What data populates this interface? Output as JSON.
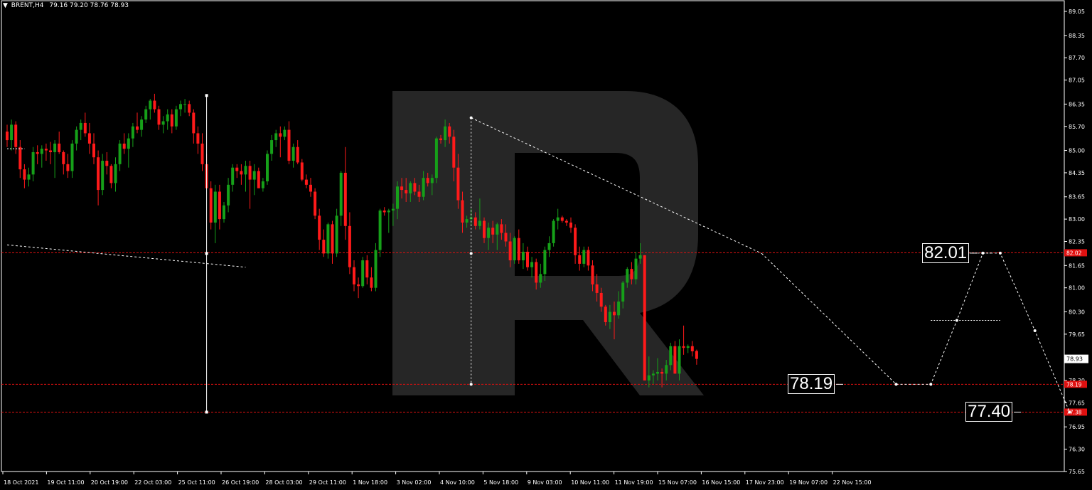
{
  "header": {
    "symbol": "BRENT,H4",
    "ohlc": "79.16 79.20 78.76 78.93"
  },
  "colors": {
    "background": "#000000",
    "bull_candle": "#16a019",
    "bear_candle": "#ff1a1a",
    "level_line": "#e01010",
    "forecast_line": "#ffffff",
    "axis_text": "#ffffff",
    "watermark": "#2b2b2b"
  },
  "chart_data": {
    "type": "candlestick",
    "ylim": [
      75.65,
      89.05
    ],
    "y_ticks": [
      "89.05",
      "88.35",
      "87.70",
      "87.05",
      "86.35",
      "85.70",
      "85.00",
      "84.35",
      "83.65",
      "83.00",
      "82.35",
      "81.65",
      "81.00",
      "80.30",
      "79.65",
      "78.98",
      "78.30",
      "77.65",
      "76.95",
      "76.30",
      "75.65"
    ],
    "x_tick_labels": [
      "18 Oct 2021",
      "19 Oct 11:00",
      "20 Oct 19:00",
      "22 Oct 03:00",
      "25 Oct 11:00",
      "26 Oct 19:00",
      "28 Oct 03:00",
      "29 Oct 11:00",
      "1 Nov 18:00",
      "3 Nov 02:00",
      "4 Nov 10:00",
      "5 Nov 18:00",
      "9 Nov 03:00",
      "10 Nov 11:00",
      "11 Nov 19:00",
      "15 Nov 07:00",
      "16 Nov 15:00",
      "17 Nov 23:00",
      "19 Nov 07:00",
      "22 Nov 15:00"
    ],
    "candles_ohlc": [
      [
        85.55,
        85.75,
        85.1,
        85.3
      ],
      [
        85.3,
        85.9,
        85.0,
        85.75
      ],
      [
        85.75,
        85.85,
        84.9,
        85.1
      ],
      [
        85.1,
        85.3,
        84.2,
        84.45
      ],
      [
        84.45,
        84.6,
        83.9,
        84.15
      ],
      [
        84.15,
        84.5,
        83.95,
        84.3
      ],
      [
        84.3,
        85.1,
        84.1,
        84.95
      ],
      [
        84.95,
        85.15,
        84.6,
        84.9
      ],
      [
        84.9,
        85.15,
        84.5,
        85.05
      ],
      [
        85.05,
        85.2,
        84.7,
        85.0
      ],
      [
        85.0,
        85.25,
        84.6,
        84.95
      ],
      [
        84.95,
        85.3,
        84.2,
        85.2
      ],
      [
        85.2,
        85.55,
        84.9,
        84.95
      ],
      [
        84.95,
        85.0,
        84.3,
        84.6
      ],
      [
        84.6,
        84.9,
        84.2,
        84.4
      ],
      [
        84.4,
        85.3,
        84.2,
        85.2
      ],
      [
        85.2,
        85.7,
        85.0,
        85.6
      ],
      [
        85.6,
        85.9,
        85.3,
        85.8
      ],
      [
        85.8,
        86.1,
        85.4,
        85.5
      ],
      [
        85.5,
        85.8,
        84.9,
        85.2
      ],
      [
        85.2,
        85.5,
        84.6,
        84.8
      ],
      [
        84.8,
        85.0,
        83.4,
        83.85
      ],
      [
        83.85,
        84.9,
        83.7,
        84.7
      ],
      [
        84.7,
        84.95,
        84.3,
        84.55
      ],
      [
        84.55,
        84.6,
        83.9,
        84.05
      ],
      [
        84.05,
        84.8,
        83.8,
        84.6
      ],
      [
        84.6,
        85.3,
        84.4,
        85.2
      ],
      [
        85.2,
        85.5,
        84.9,
        85.05
      ],
      [
        85.05,
        85.5,
        84.5,
        85.35
      ],
      [
        85.35,
        85.8,
        85.1,
        85.7
      ],
      [
        85.7,
        86.1,
        85.5,
        85.6
      ],
      [
        85.6,
        86.0,
        85.4,
        85.9
      ],
      [
        85.9,
        86.3,
        85.8,
        86.2
      ],
      [
        86.2,
        86.5,
        85.9,
        86.45
      ],
      [
        86.45,
        86.65,
        86.1,
        86.2
      ],
      [
        86.2,
        86.3,
        85.6,
        85.75
      ],
      [
        85.75,
        86.0,
        85.5,
        85.85
      ],
      [
        85.85,
        86.2,
        85.6,
        86.05
      ],
      [
        86.05,
        86.2,
        85.5,
        85.7
      ],
      [
        85.7,
        86.3,
        85.6,
        86.2
      ],
      [
        86.2,
        86.45,
        86.0,
        86.35
      ],
      [
        86.35,
        86.5,
        86.1,
        86.35
      ],
      [
        86.35,
        86.45,
        86.0,
        86.1
      ],
      [
        86.1,
        86.2,
        85.2,
        85.5
      ],
      [
        85.5,
        85.7,
        84.9,
        85.2
      ],
      [
        85.2,
        85.5,
        84.4,
        84.6
      ],
      [
        84.6,
        84.9,
        83.9,
        83.9
      ],
      [
        83.9,
        84.1,
        82.7,
        82.9
      ],
      [
        82.9,
        84.0,
        82.3,
        83.8
      ],
      [
        83.8,
        84.0,
        82.7,
        83.0
      ],
      [
        83.0,
        83.5,
        82.9,
        83.4
      ],
      [
        83.4,
        84.2,
        83.2,
        84.0
      ],
      [
        84.0,
        84.6,
        83.8,
        84.5
      ],
      [
        84.5,
        84.6,
        84.2,
        84.4
      ],
      [
        84.4,
        84.6,
        84.0,
        84.3
      ],
      [
        84.3,
        84.7,
        83.8,
        84.55
      ],
      [
        84.55,
        84.7,
        83.3,
        84.15
      ],
      [
        84.15,
        84.6,
        83.7,
        84.4
      ],
      [
        84.4,
        84.5,
        83.9,
        83.9
      ],
      [
        83.9,
        84.2,
        83.8,
        84.1
      ],
      [
        84.1,
        85.0,
        84.0,
        84.9
      ],
      [
        84.9,
        85.45,
        84.7,
        85.3
      ],
      [
        85.3,
        85.6,
        85.1,
        85.5
      ],
      [
        85.5,
        85.7,
        84.8,
        85.4
      ],
      [
        85.4,
        85.7,
        85.3,
        85.6
      ],
      [
        85.6,
        85.85,
        84.6,
        84.7
      ],
      [
        84.7,
        85.2,
        84.5,
        85.1
      ],
      [
        85.1,
        85.3,
        84.6,
        84.65
      ],
      [
        84.65,
        84.75,
        84.1,
        84.15
      ],
      [
        84.15,
        84.3,
        83.9,
        84.0
      ],
      [
        84.0,
        84.2,
        83.65,
        83.8
      ],
      [
        83.8,
        83.9,
        83.0,
        83.1
      ],
      [
        83.1,
        83.3,
        82.1,
        82.4
      ],
      [
        82.4,
        82.7,
        81.9,
        82.0
      ],
      [
        82.0,
        82.9,
        81.85,
        82.85
      ],
      [
        82.85,
        82.95,
        81.7,
        82.0
      ],
      [
        82.0,
        83.3,
        81.9,
        83.1
      ],
      [
        83.1,
        84.4,
        82.8,
        84.35
      ],
      [
        84.35,
        85.1,
        82.4,
        82.8
      ],
      [
        82.8,
        83.2,
        81.4,
        81.6
      ],
      [
        81.6,
        81.8,
        80.9,
        81.1
      ],
      [
        81.1,
        81.3,
        80.7,
        81.05
      ],
      [
        81.05,
        81.9,
        81.0,
        81.8
      ],
      [
        81.8,
        81.95,
        81.1,
        81.3
      ],
      [
        81.3,
        81.6,
        80.9,
        81.0
      ],
      [
        81.0,
        82.3,
        80.9,
        82.1
      ],
      [
        82.1,
        83.3,
        81.9,
        83.25
      ],
      [
        83.25,
        83.35,
        83.1,
        83.2
      ],
      [
        83.2,
        83.3,
        82.6,
        83.25
      ],
      [
        83.25,
        83.45,
        82.8,
        83.3
      ],
      [
        83.3,
        84.1,
        83.0,
        83.95
      ],
      [
        83.95,
        84.2,
        83.6,
        83.85
      ],
      [
        83.85,
        84.2,
        83.5,
        83.75
      ],
      [
        83.75,
        84.1,
        83.5,
        84.05
      ],
      [
        84.05,
        84.2,
        83.7,
        83.8
      ],
      [
        83.8,
        84.0,
        83.5,
        83.65
      ],
      [
        83.65,
        84.4,
        83.55,
        84.2
      ],
      [
        84.2,
        84.35,
        83.95,
        84.05
      ],
      [
        84.05,
        84.3,
        83.7,
        84.2
      ],
      [
        84.2,
        85.4,
        84.05,
        85.35
      ],
      [
        85.35,
        85.45,
        85.2,
        85.3
      ],
      [
        85.3,
        85.9,
        85.1,
        85.7
      ],
      [
        85.7,
        85.8,
        85.2,
        85.4
      ],
      [
        85.4,
        85.6,
        84.1,
        84.5
      ],
      [
        84.5,
        84.9,
        83.3,
        83.55
      ],
      [
        83.55,
        83.8,
        82.6,
        82.9
      ],
      [
        82.9,
        83.1,
        82.75,
        83.0
      ],
      [
        83.0,
        83.3,
        82.8,
        83.05
      ],
      [
        83.05,
        83.2,
        82.7,
        82.8
      ],
      [
        82.8,
        83.6,
        82.7,
        82.95
      ],
      [
        82.95,
        83.05,
        82.3,
        82.45
      ],
      [
        82.45,
        82.9,
        82.1,
        82.75
      ],
      [
        82.75,
        82.95,
        82.3,
        82.55
      ],
      [
        82.55,
        82.9,
        82.1,
        82.85
      ],
      [
        82.85,
        83.0,
        82.4,
        82.6
      ],
      [
        82.6,
        82.85,
        82.2,
        82.35
      ],
      [
        82.35,
        82.6,
        81.6,
        81.8
      ],
      [
        81.8,
        82.5,
        81.7,
        82.45
      ],
      [
        82.45,
        82.7,
        81.7,
        81.8
      ],
      [
        81.8,
        82.3,
        81.55,
        82.05
      ],
      [
        82.05,
        82.2,
        81.5,
        81.6
      ],
      [
        81.6,
        81.9,
        81.3,
        81.75
      ],
      [
        81.75,
        81.85,
        80.95,
        81.15
      ],
      [
        81.15,
        81.7,
        81.0,
        81.4
      ],
      [
        81.4,
        82.2,
        81.2,
        82.1
      ],
      [
        82.1,
        82.5,
        81.9,
        82.3
      ],
      [
        82.3,
        83.0,
        82.2,
        82.95
      ],
      [
        82.95,
        83.3,
        82.7,
        83.05
      ],
      [
        83.05,
        83.1,
        82.9,
        82.95
      ],
      [
        82.95,
        83.0,
        82.8,
        82.9
      ],
      [
        82.9,
        83.05,
        82.6,
        82.75
      ],
      [
        82.75,
        82.85,
        81.7,
        81.95
      ],
      [
        81.95,
        82.2,
        81.5,
        81.7
      ],
      [
        81.7,
        82.2,
        81.6,
        82.1
      ],
      [
        82.1,
        82.2,
        81.5,
        81.65
      ],
      [
        81.65,
        81.8,
        80.9,
        81.1
      ],
      [
        81.1,
        81.4,
        80.6,
        80.85
      ],
      [
        80.85,
        81.0,
        80.3,
        80.45
      ],
      [
        80.45,
        80.5,
        79.9,
        80.0
      ],
      [
        80.0,
        80.5,
        79.8,
        80.3
      ],
      [
        80.3,
        80.6,
        79.5,
        80.2
      ],
      [
        80.2,
        80.9,
        80.1,
        80.6
      ],
      [
        80.6,
        81.2,
        80.4,
        81.15
      ],
      [
        81.15,
        81.6,
        81.0,
        81.55
      ],
      [
        81.55,
        81.75,
        81.1,
        81.25
      ],
      [
        81.25,
        82.05,
        81.1,
        81.85
      ],
      [
        81.85,
        82.3,
        81.7,
        81.95
      ],
      [
        81.95,
        81.95,
        78.3,
        78.3
      ],
      [
        78.3,
        79.0,
        78.1,
        78.45
      ],
      [
        78.45,
        78.6,
        78.2,
        78.5
      ],
      [
        78.5,
        78.95,
        78.3,
        78.55
      ],
      [
        78.55,
        78.65,
        78.1,
        78.5
      ],
      [
        78.5,
        78.9,
        78.3,
        78.75
      ],
      [
        78.75,
        79.4,
        78.6,
        79.3
      ],
      [
        79.3,
        79.45,
        78.5,
        78.5
      ],
      [
        78.5,
        79.5,
        78.3,
        79.3
      ],
      [
        79.3,
        79.9,
        79.05,
        79.25
      ],
      [
        79.25,
        79.35,
        79.1,
        79.3
      ],
      [
        79.3,
        79.45,
        79.0,
        79.15
      ],
      [
        79.16,
        79.2,
        78.76,
        78.93
      ]
    ],
    "markers": [
      {
        "type": "dotted_horizontal",
        "from_index": 0,
        "to_index": 4,
        "value": 85.05,
        "color": "#ffffff"
      },
      {
        "type": "dotted_line",
        "from": [
          0,
          82.25
        ],
        "to": [
          55,
          81.6
        ],
        "color": "#ffffff"
      },
      {
        "type": "vertical_line",
        "at_index": 46,
        "from_value": 86.6,
        "to_value": 77.38,
        "color": "#ffffff"
      },
      {
        "type": "dotted_vertical",
        "at_index": 107,
        "from_value": 85.95,
        "to_value": 78.19,
        "color": "#ffffff"
      },
      {
        "type": "dotted_line",
        "from": [
          107,
          85.95
        ],
        "to": [
          174,
          82.0
        ],
        "color": "#ffffff"
      },
      {
        "type": "dotted_line",
        "from": [
          174,
          82.0
        ],
        "to": [
          205,
          78.19
        ],
        "color": "#ffffff"
      }
    ],
    "forecast_points": [
      [
        205,
        78.19
      ],
      [
        213,
        78.19
      ],
      [
        219,
        80.05
      ],
      [
        225,
        82.01
      ],
      [
        229,
        82.01
      ],
      [
        237,
        79.75
      ],
      [
        245,
        77.38
      ]
    ],
    "forecast_extra": [
      {
        "type": "dotted_horizontal",
        "from_index": 213,
        "to_index": 229,
        "value": 80.05
      },
      {
        "type": "dotted_horizontal",
        "from_index": 218,
        "to_index": 227,
        "value": 82.01
      }
    ],
    "levels": [
      {
        "value": 82.02,
        "label": "82.02"
      },
      {
        "value": 78.19,
        "label": "78.19"
      },
      {
        "value": 77.38,
        "label": "77.38"
      }
    ],
    "current_price": {
      "value": 78.93,
      "label": "78.93"
    },
    "annotations": [
      {
        "text": "82.01",
        "value": 82.01,
        "index": 211
      },
      {
        "text": "78.19",
        "value": 78.19,
        "index": 180
      },
      {
        "text": "77.40",
        "value": 77.38,
        "index": 221
      }
    ],
    "extra_line": {
      "from": [
        268,
        76.95
      ],
      "to": [
        273,
        78.6
      ]
    }
  }
}
